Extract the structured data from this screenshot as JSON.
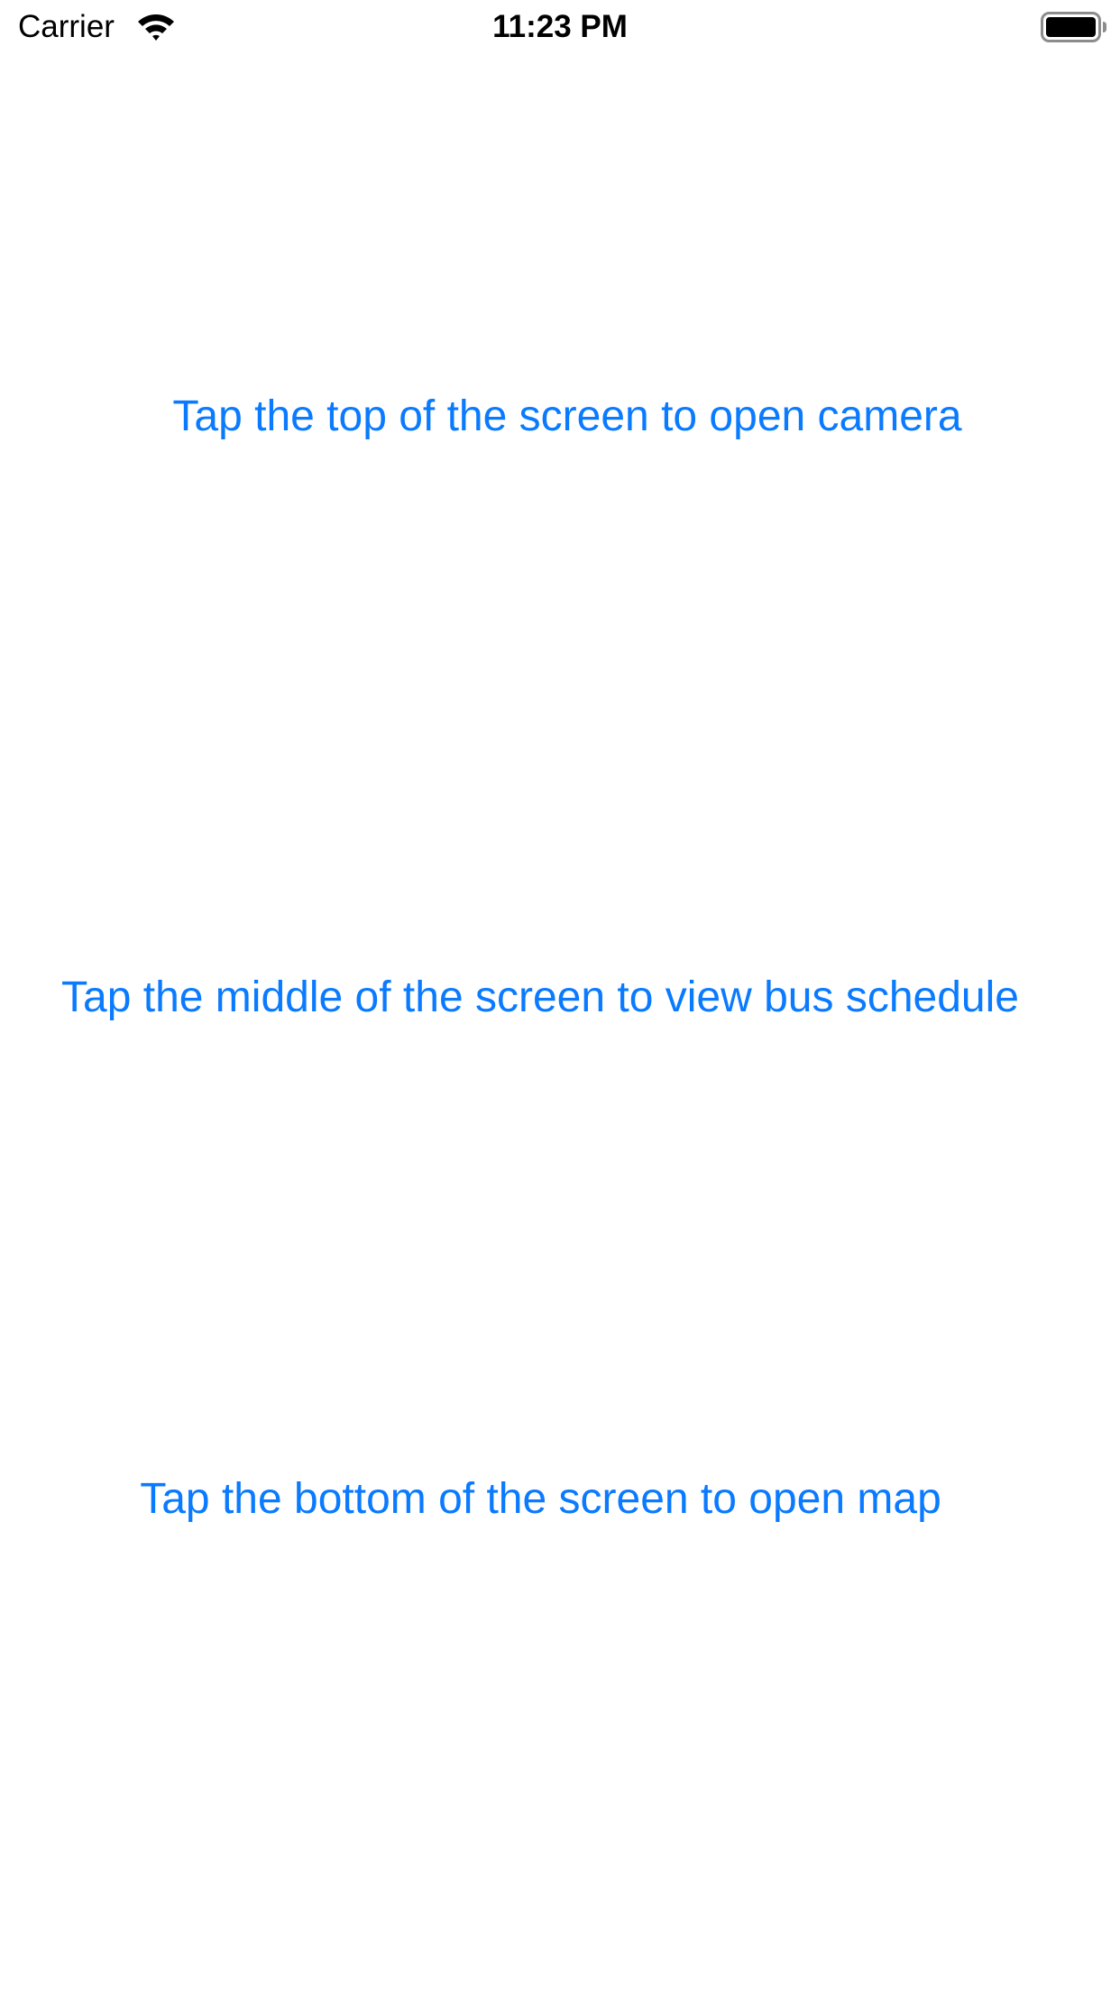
{
  "status_bar": {
    "carrier": "Carrier",
    "time": "11:23 PM",
    "icons": [
      "wifi-icon",
      "battery-icon"
    ]
  },
  "zones": {
    "top": {
      "label": "Tap the top of the screen to open camera"
    },
    "middle": {
      "label": "Tap the middle of the screen to view bus schedule"
    },
    "bottom": {
      "label": "Tap the bottom of the screen to open map"
    }
  },
  "colors": {
    "accent": "#0a7aff",
    "background": "#ffffff",
    "status_text": "#000000"
  }
}
